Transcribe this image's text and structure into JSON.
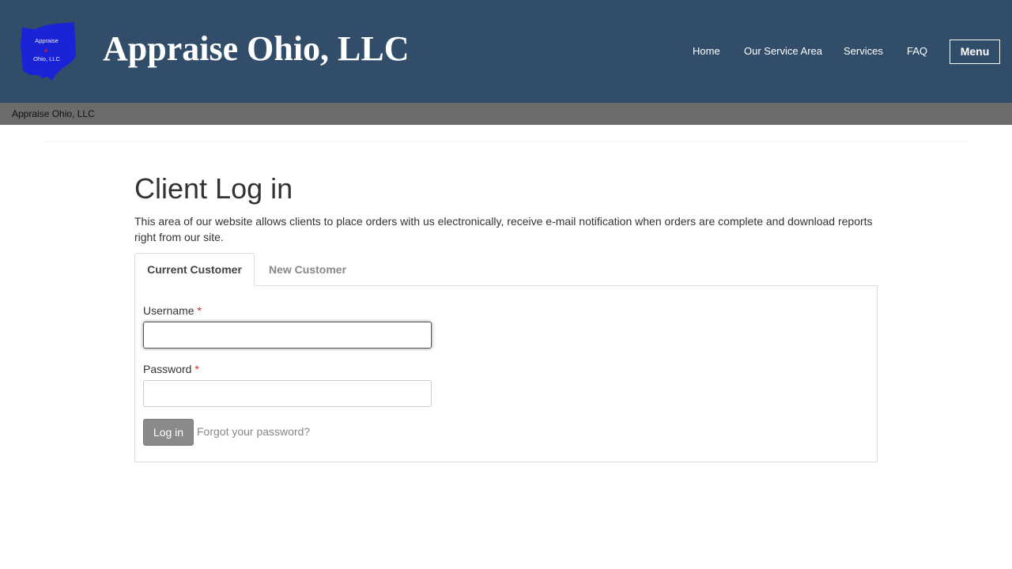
{
  "header": {
    "logo_text_line1": "Appraise",
    "logo_text_line2": "Ohio, LLC",
    "site_title": "Appraise Ohio, LLC",
    "nav": [
      "Home",
      "Our Service Area",
      "Services",
      "FAQ"
    ],
    "menu_label": "Menu",
    "background_color": "#324d6a"
  },
  "breadcrumb": {
    "label": "Appraise Ohio, LLC"
  },
  "main": {
    "title": "Client Log in",
    "intro": "This area of our website allows clients to place orders with us electronically, receive e-mail notification when orders are complete and download reports right from our site.",
    "tabs": [
      {
        "label": "Current Customer",
        "active": true
      },
      {
        "label": "New Customer",
        "active": false
      }
    ],
    "form": {
      "username_label": "Username",
      "username_value": "",
      "password_label": "Password",
      "password_value": "",
      "required_marker": "*",
      "login_label": "Log in",
      "forgot_label": "Forgot your password?"
    }
  },
  "icons": {
    "logo": "ohio-state-map-logo"
  }
}
